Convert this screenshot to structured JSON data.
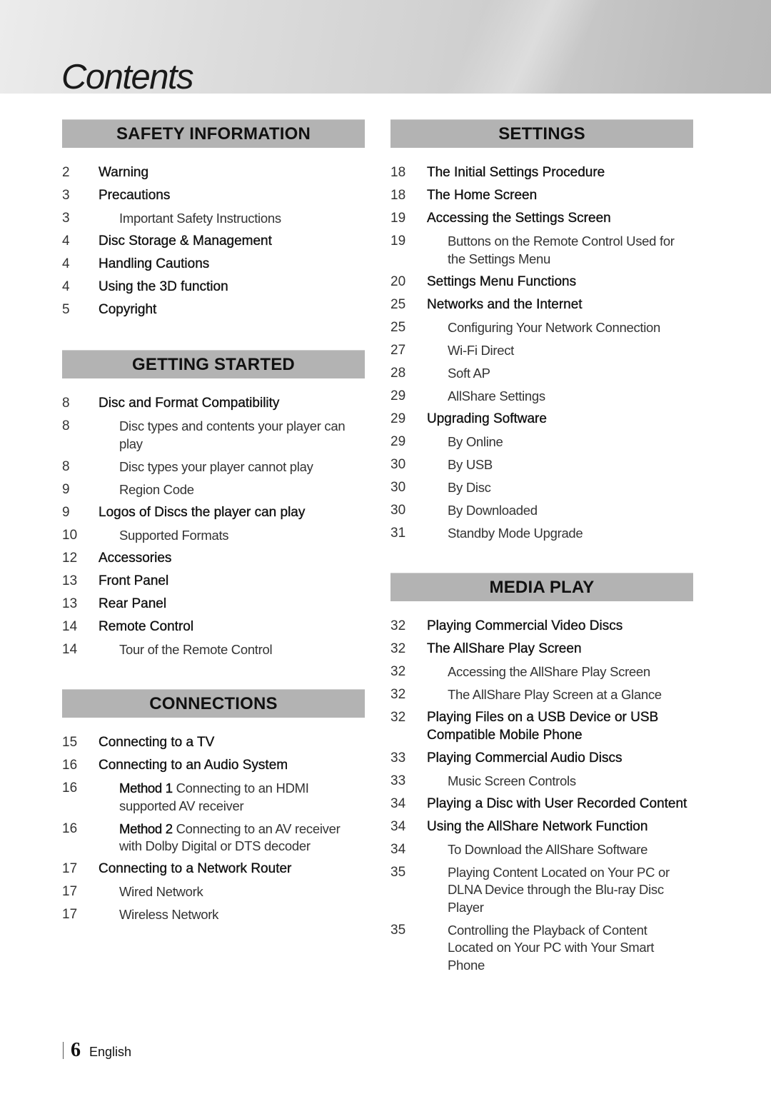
{
  "page": {
    "title": "Contents",
    "page_number": "6",
    "language": "English"
  },
  "sections": {
    "safety": {
      "title": "SAFETY INFORMATION",
      "items": [
        {
          "page": "2",
          "text": "Warning",
          "level": 1
        },
        {
          "page": "3",
          "text": "Precautions",
          "level": 1
        },
        {
          "page": "3",
          "text": "Important Safety Instructions",
          "level": 2
        },
        {
          "page": "4",
          "text": "Disc Storage & Management",
          "level": 1
        },
        {
          "page": "4",
          "text": "Handling Cautions",
          "level": 1
        },
        {
          "page": "4",
          "text": "Using the 3D function",
          "level": 1
        },
        {
          "page": "5",
          "text": "Copyright",
          "level": 1
        }
      ]
    },
    "getting_started": {
      "title": "GETTING STARTED",
      "items": [
        {
          "page": "8",
          "text": "Disc and Format Compatibility",
          "level": 1
        },
        {
          "page": "8",
          "text": "Disc types and contents your player can play",
          "level": 2
        },
        {
          "page": "8",
          "text": "Disc types your player cannot play",
          "level": 2
        },
        {
          "page": "9",
          "text": "Region Code",
          "level": 2
        },
        {
          "page": "9",
          "text": "Logos of Discs the player can play",
          "level": 1
        },
        {
          "page": "10",
          "text": "Supported Formats",
          "level": 2
        },
        {
          "page": "12",
          "text": "Accessories",
          "level": 1
        },
        {
          "page": "13",
          "text": "Front Panel",
          "level": 1
        },
        {
          "page": "13",
          "text": "Rear Panel",
          "level": 1
        },
        {
          "page": "14",
          "text": "Remote Control",
          "level": 1
        },
        {
          "page": "14",
          "text": "Tour of the Remote Control",
          "level": 2
        }
      ]
    },
    "connections": {
      "title": "CONNECTIONS",
      "items": [
        {
          "page": "15",
          "text": "Connecting to a TV",
          "level": 1
        },
        {
          "page": "16",
          "text": "Connecting to an Audio System",
          "level": 1
        },
        {
          "page": "16",
          "label": "Method 1",
          "text": "Connecting to an HDMI supported AV receiver",
          "level": 2
        },
        {
          "page": "16",
          "label": "Method 2",
          "text": "Connecting to an AV receiver with Dolby Digital or DTS decoder",
          "level": 2
        },
        {
          "page": "17",
          "text": "Connecting to a Network Router",
          "level": 1
        },
        {
          "page": "17",
          "text": "Wired Network",
          "level": 2
        },
        {
          "page": "17",
          "text": "Wireless Network",
          "level": 2
        }
      ]
    },
    "settings": {
      "title": "SETTINGS",
      "items": [
        {
          "page": "18",
          "text": "The Initial Settings Procedure",
          "level": 1
        },
        {
          "page": "18",
          "text": "The Home Screen",
          "level": 1
        },
        {
          "page": "19",
          "text": "Accessing the Settings Screen",
          "level": 1
        },
        {
          "page": "19",
          "text": "Buttons on the Remote Control Used for the Settings Menu",
          "level": 2
        },
        {
          "page": "20",
          "text": "Settings Menu Functions",
          "level": 1
        },
        {
          "page": "25",
          "text": "Networks and the Internet",
          "level": 1
        },
        {
          "page": "25",
          "text": "Configuring Your Network Connection",
          "level": 2
        },
        {
          "page": "27",
          "text": "Wi-Fi Direct",
          "level": 2
        },
        {
          "page": "28",
          "text": "Soft AP",
          "level": 2
        },
        {
          "page": "29",
          "text": "AllShare Settings",
          "level": 2
        },
        {
          "page": "29",
          "text": "Upgrading Software",
          "level": 1
        },
        {
          "page": "29",
          "text": "By Online",
          "level": 2
        },
        {
          "page": "30",
          "text": "By USB",
          "level": 2
        },
        {
          "page": "30",
          "text": "By Disc",
          "level": 2
        },
        {
          "page": "30",
          "text": "By Downloaded",
          "level": 2
        },
        {
          "page": "31",
          "text": "Standby Mode Upgrade",
          "level": 2
        }
      ]
    },
    "media_play": {
      "title": "MEDIA PLAY",
      "items": [
        {
          "page": "32",
          "text": "Playing Commercial Video Discs",
          "level": 1
        },
        {
          "page": "32",
          "text": "The AllShare Play Screen",
          "level": 1
        },
        {
          "page": "32",
          "text": "Accessing the AllShare Play Screen",
          "level": 2
        },
        {
          "page": "32",
          "text": "The AllShare Play Screen at a Glance",
          "level": 2
        },
        {
          "page": "32",
          "text": "Playing Files on a USB Device or USB Compatible Mobile Phone",
          "level": 1
        },
        {
          "page": "33",
          "text": "Playing Commercial Audio Discs",
          "level": 1
        },
        {
          "page": "33",
          "text": "Music Screen Controls",
          "level": 2
        },
        {
          "page": "34",
          "text": "Playing a Disc with User Recorded Content",
          "level": 1
        },
        {
          "page": "34",
          "text": "Using the AllShare Network Function",
          "level": 1
        },
        {
          "page": "34",
          "text": "To Download the AllShare Software",
          "level": 2
        },
        {
          "page": "35",
          "text": "Playing Content Located on Your PC or DLNA Device through the Blu-ray Disc Player",
          "level": 2
        },
        {
          "page": "35",
          "text": "Controlling the Playback of Content Located on Your PC with Your Smart Phone",
          "level": 2
        }
      ]
    }
  }
}
